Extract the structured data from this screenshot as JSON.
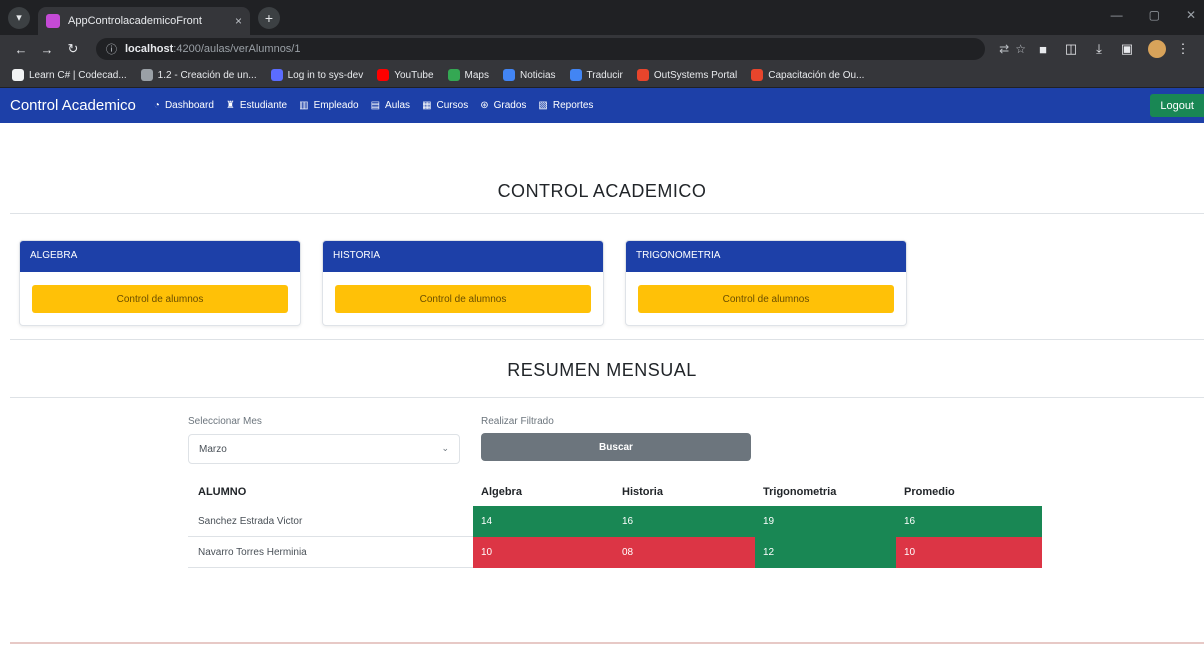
{
  "browser": {
    "tab_title": "AppControlacademicoFront",
    "tab_close": "×",
    "new_tab": "+",
    "url_host": "localhost",
    "url_path": ":4200/aulas/verAlumnos/1",
    "bookmarks": [
      {
        "label": "Learn C# | Codecad...",
        "color": "#f1f3f4"
      },
      {
        "label": "1.2 - Creación de un...",
        "color": "#9aa0a6"
      },
      {
        "label": "Log in to sys-dev",
        "color": "#5b6cff"
      },
      {
        "label": "YouTube",
        "color": "#ff0000"
      },
      {
        "label": "Maps",
        "color": "#34a853"
      },
      {
        "label": "Noticias",
        "color": "#4285f4"
      },
      {
        "label": "Traducir",
        "color": "#4285f4"
      },
      {
        "label": "OutSystems Portal",
        "color": "#e8452c"
      },
      {
        "label": "Capacitación de Ou...",
        "color": "#e8452c"
      }
    ]
  },
  "navbar": {
    "brand": "Control Academico",
    "items": [
      {
        "label": "Dashboard",
        "icon": "dashboard-icon"
      },
      {
        "label": "Estudiante",
        "icon": "student-icon"
      },
      {
        "label": "Empleado",
        "icon": "employee-icon"
      },
      {
        "label": "Aulas",
        "icon": "classroom-icon"
      },
      {
        "label": "Cursos",
        "icon": "courses-icon"
      },
      {
        "label": "Grados",
        "icon": "grades-icon"
      },
      {
        "label": "Reportes",
        "icon": "reports-icon"
      }
    ],
    "logout": "Logout"
  },
  "main": {
    "title": "CONTROL ACADEMICO",
    "courses": [
      {
        "name": "ALGEBRA",
        "button": "Control de alumnos"
      },
      {
        "name": "HISTORIA",
        "button": "Control de alumnos"
      },
      {
        "name": "TRIGONOMETRIA",
        "button": "Control de alumnos"
      }
    ],
    "summary_title": "RESUMEN MENSUAL",
    "filter": {
      "month_label": "Seleccionar Mes",
      "month_value": "Marzo",
      "action_label": "Realizar Filtrado",
      "search_button": "Buscar"
    },
    "table": {
      "headers": [
        "ALUMNO",
        "Algebra",
        "Historia",
        "Trigonometria",
        "Promedio"
      ],
      "rows": [
        {
          "name": "Sanchez Estrada Victor",
          "grades": [
            "14",
            "16",
            "19",
            "16"
          ],
          "status": [
            "ok",
            "ok",
            "ok",
            "ok"
          ]
        },
        {
          "name": "Navarro Torres Herminia",
          "grades": [
            "10",
            "08",
            "12",
            "10"
          ],
          "status": [
            "bad",
            "bad",
            "ok",
            "bad"
          ]
        }
      ]
    }
  },
  "colors": {
    "navbar": "#1d40a8",
    "warning": "#ffc107",
    "pass": "#198754",
    "fail": "#dc3545",
    "logout": "#198754"
  }
}
